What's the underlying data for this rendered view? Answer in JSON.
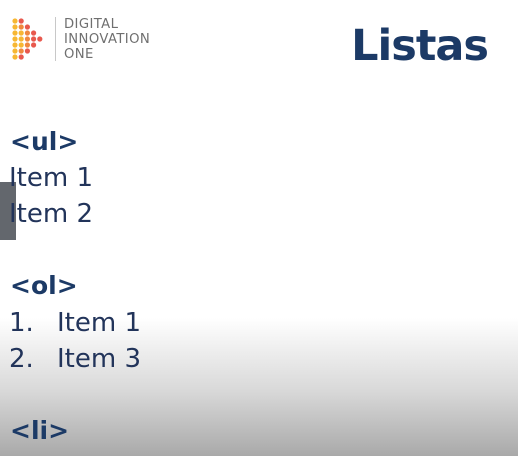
{
  "logo": {
    "line1": "DIGITAL",
    "line2": "INNOVATION",
    "line3": "ONE",
    "icon": "dot-triangle-logo",
    "colors": [
      "#f7b733",
      "#f0883e",
      "#e8594e"
    ]
  },
  "title": "Listas",
  "sections": {
    "ul": {
      "tag": "<ul>",
      "items": [
        "Item 1",
        "Item 2"
      ]
    },
    "ol": {
      "tag": "<ol>",
      "numbers": [
        "1.",
        "2."
      ],
      "items": [
        "Item 1",
        "Item 3"
      ]
    },
    "li": {
      "tag": "<li>"
    }
  },
  "colors": {
    "heading": "#1c3a66",
    "text": "#22345a",
    "side_tab": "#63676d"
  }
}
